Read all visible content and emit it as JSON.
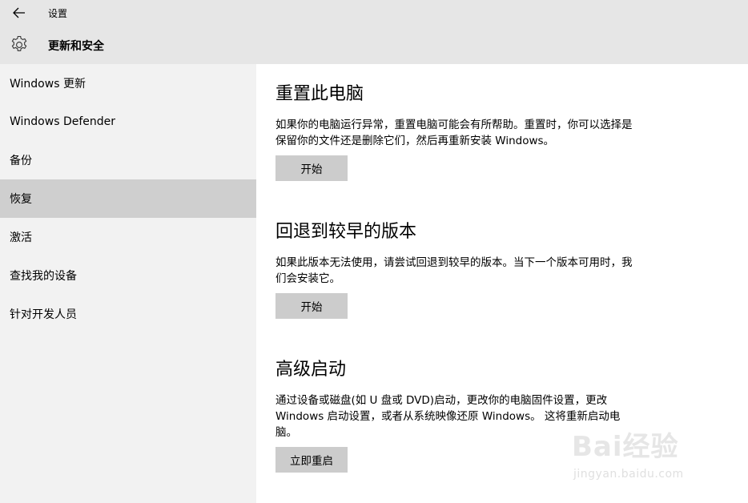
{
  "titlebar": {
    "app_title": "设置",
    "section_title": "更新和安全"
  },
  "sidebar": {
    "items": [
      {
        "label": "Windows 更新"
      },
      {
        "label": "Windows Defender"
      },
      {
        "label": "备份"
      },
      {
        "label": "恢复"
      },
      {
        "label": "激活"
      },
      {
        "label": "查找我的设备"
      },
      {
        "label": "针对开发人员"
      }
    ],
    "active_item": "恢复"
  },
  "content": {
    "sections": [
      {
        "title": "重置此电脑",
        "description": "如果你的电脑运行异常，重置电脑可能会有所帮助。重置时，你可以选择是保留你的文件还是删除它们，然后再重新安装 Windows。",
        "button_label": "开始"
      },
      {
        "title": "回退到较早的版本",
        "description": "如果此版本无法使用，请尝试回退到较早的版本。当下一个版本可用时，我们会安装它。",
        "button_label": "开始"
      },
      {
        "title": "高级启动",
        "description": "通过设备或磁盘(如 U 盘或 DVD)启动，更改你的电脑固件设置，更改 Windows 启动设置，或者从系统映像还原 Windows。 这将重新启动电脑。",
        "button_label": "立即重启"
      }
    ]
  },
  "watermark": {
    "logo_text": "Bai经验",
    "url": "jingyan.baidu.com"
  },
  "icons": {
    "back": "back-arrow-icon",
    "settings": "gear-icon"
  },
  "colors": {
    "titlebar_bg": "#e6e6e6",
    "sidebar_bg": "#f2f2f2",
    "active_item_bg": "#cfcfcf",
    "button_bg": "#cccccc"
  }
}
